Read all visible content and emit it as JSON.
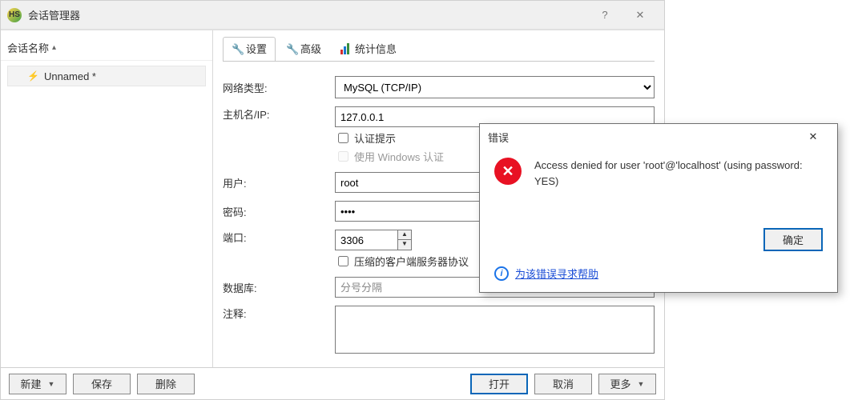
{
  "window": {
    "title": "会话管理器",
    "help_glyph": "?",
    "close_glyph": "✕"
  },
  "sidebar": {
    "column_header": "会话名称",
    "sessions": [
      {
        "label": "Unnamed *"
      }
    ]
  },
  "tabs": {
    "settings": "设置",
    "advanced": "高级",
    "stats": "统计信息"
  },
  "form": {
    "net_type_label": "网络类型:",
    "net_type_value": "MySQL (TCP/IP)",
    "host_label": "主机名/IP:",
    "host_value": "127.0.0.1",
    "auth_prompt_label": "认证提示",
    "use_windows_auth_label": "使用 Windows 认证",
    "user_label": "用户:",
    "user_value": "root",
    "password_label": "密码:",
    "password_value": "••••",
    "port_label": "端口:",
    "port_value": "3306",
    "compressed_label": "压缩的客户端服务器协议",
    "databases_label": "数据库:",
    "databases_placeholder": "分号分隔",
    "comment_label": "注释:"
  },
  "footer": {
    "new": "新建",
    "save": "保存",
    "delete": "删除",
    "open": "打开",
    "cancel": "取消",
    "more": "更多"
  },
  "error": {
    "title": "错误",
    "message": "Access denied for user 'root'@'localhost' (using password: YES)",
    "ok": "确定",
    "help_link": "为该错误寻求帮助"
  }
}
